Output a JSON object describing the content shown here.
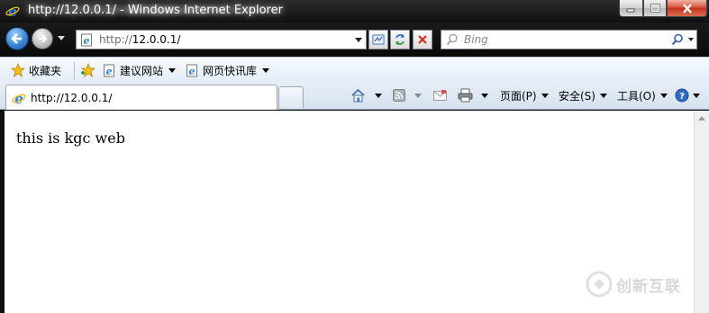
{
  "window": {
    "title": "http://12.0.0.1/ - Windows Internet Explorer"
  },
  "address": {
    "prefix": "http://",
    "host": "12.0.0.1/"
  },
  "search": {
    "placeholder": "Bing"
  },
  "favorites": {
    "label": "收藏夹",
    "items": [
      {
        "label": "建议网站",
        "icon": "ie-page-icon"
      },
      {
        "label": "网页快讯库",
        "icon": "ie-page-icon"
      }
    ]
  },
  "tab": {
    "title": "http://12.0.0.1/"
  },
  "commands": {
    "page": "页面(P)",
    "safety": "安全(S)",
    "tools": "工具(O)"
  },
  "page": {
    "body_text": "this is kgc web"
  },
  "watermark": {
    "text": "创新互联"
  },
  "colors": {
    "ie_blue": "#1c6fcf",
    "ie_gold": "#f5b70a",
    "close_red": "#c3331b"
  }
}
